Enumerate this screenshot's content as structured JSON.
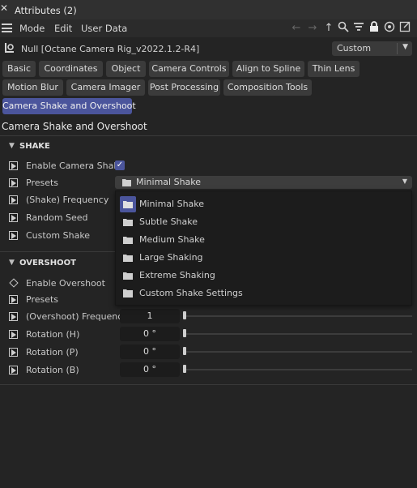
{
  "window": {
    "title": "Attributes (2)"
  },
  "menu": {
    "items": [
      "Mode",
      "Edit",
      "User Data"
    ]
  },
  "object": {
    "title": "Null [Octane Camera Rig_v2022.1.2-R4]",
    "layer_select": "Custom"
  },
  "tabs": [
    "Basic",
    "Coordinates",
    "Object",
    "Camera Controls",
    "Align to Spline",
    "Thin Lens",
    "Motion Blur",
    "Camera Imager",
    "Post Processing",
    "Composition Tools",
    "Camera Shake and Overshoot"
  ],
  "section": {
    "title": "Camera Shake and Overshoot"
  },
  "shake": {
    "group_title": "SHAKE",
    "enable_label": "Enable Camera Shake",
    "enable_checked": true,
    "presets_label": "Presets",
    "presets_value": "Minimal Shake",
    "frequency_label": "(Shake) Frequency",
    "seed_label": "Random Seed",
    "custom_label": "Custom Shake"
  },
  "preset_menu": {
    "items": [
      "Minimal Shake",
      "Subtle Shake",
      "Medium Shake",
      "Large Shaking",
      "Extreme Shaking",
      "Custom Shake Settings"
    ],
    "selected_index": 0
  },
  "overshoot": {
    "group_title": "OVERSHOOT",
    "enable_label": "Enable Overshoot",
    "presets_label": "Presets",
    "frequency_label": "(Overshoot) Frequency",
    "frequency_value": "1",
    "rot_h_label": "Rotation (H)",
    "rot_h_value": "0 °",
    "rot_p_label": "Rotation (P)",
    "rot_p_value": "0 °",
    "rot_b_label": "Rotation (B)",
    "rot_b_value": "0 °"
  },
  "colors": {
    "accent": "#4b559c",
    "panel_bg": "#242424",
    "button_bg": "#3b3b3b"
  }
}
